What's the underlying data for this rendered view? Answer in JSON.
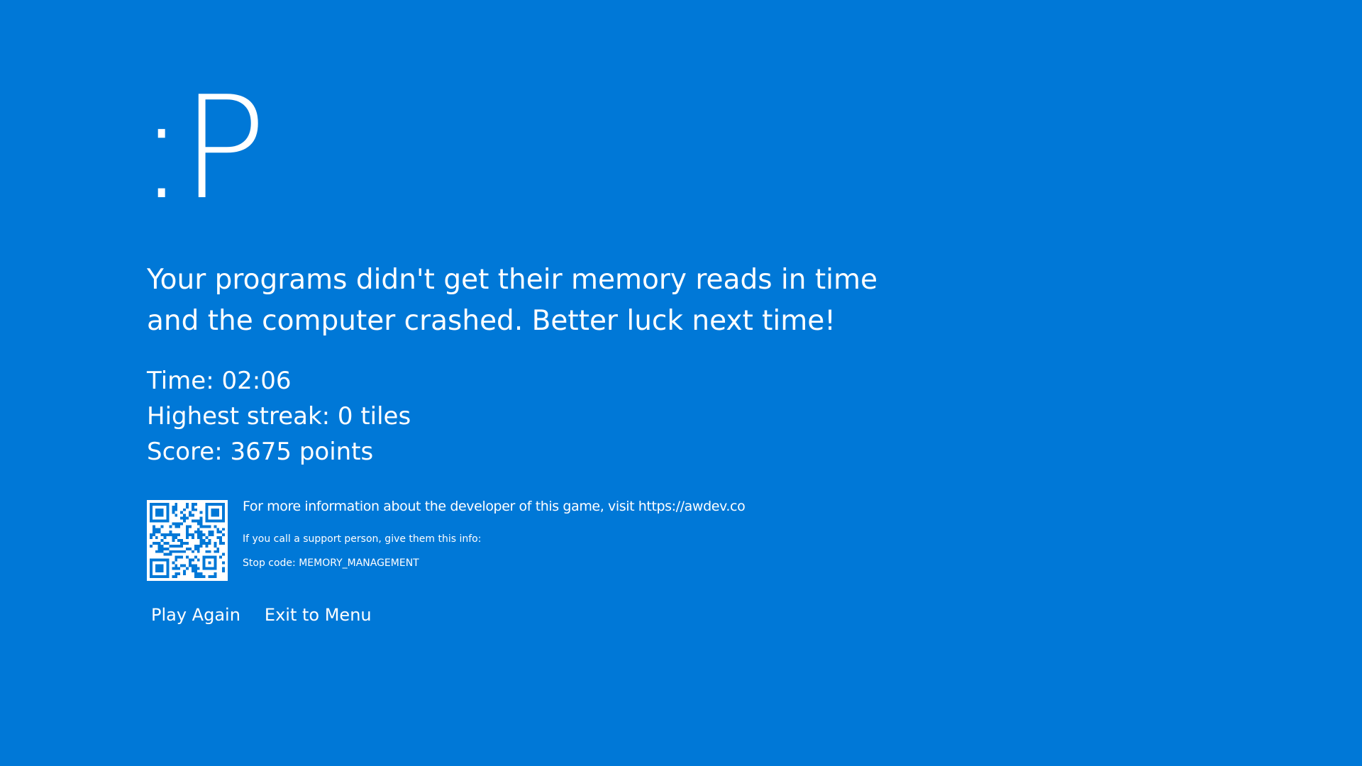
{
  "screen": {
    "face": ":P",
    "message": "Your programs didn't get their memory reads in time and the computer crashed. Better luck next time!",
    "background_color": "#0078d7",
    "text_color": "#ffffff"
  },
  "stats": {
    "time": "Time: 02:06",
    "streak": "Highest streak: 0 tiles",
    "score": "Score: 3675 points"
  },
  "info": {
    "qr_icon": "qr-code-icon",
    "developer": "For more information about the developer of this game, visit https://awdev.co",
    "support": "If you call a support person, give them this info:",
    "stop_code": "Stop code: MEMORY_MANAGEMENT"
  },
  "actions": {
    "play_again": "Play Again",
    "exit_menu": "Exit to Menu"
  }
}
